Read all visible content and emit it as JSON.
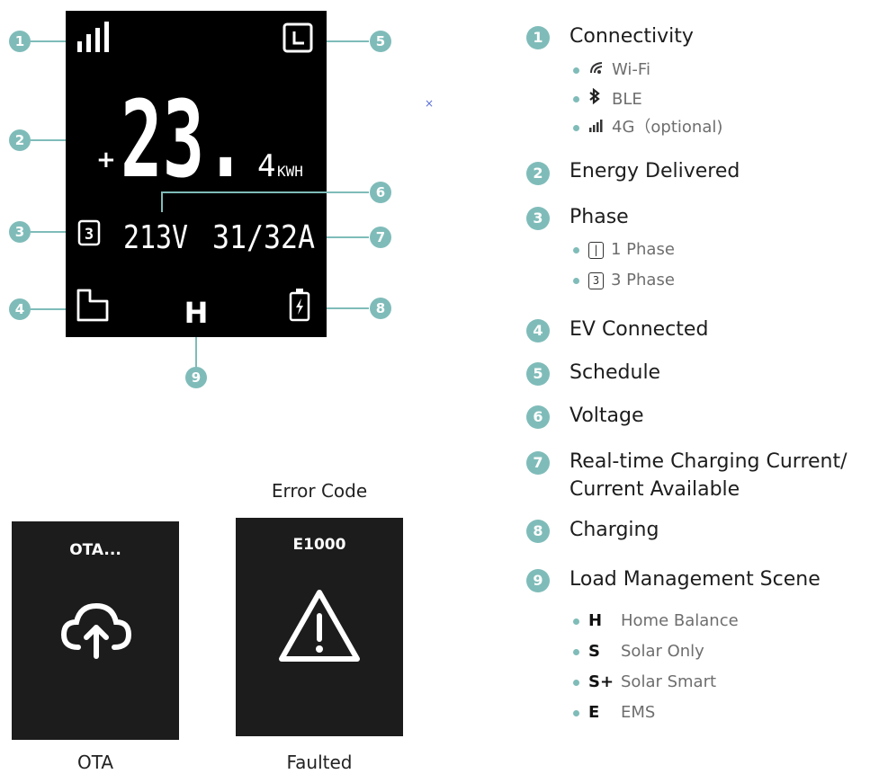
{
  "display": {
    "energy_big": "23.",
    "energy_decimal": "4",
    "energy_unit": "KWH",
    "plus_sign": "+",
    "phase_digit": "3",
    "voltage": "213V",
    "current": "31/32A",
    "scene": "H"
  },
  "callouts": [
    "1",
    "2",
    "3",
    "4",
    "5",
    "6",
    "7",
    "8",
    "9"
  ],
  "stray_mark": "×",
  "legend": {
    "items": [
      {
        "num": "1",
        "title": "Connectivity",
        "subs": [
          {
            "icon": "wifi-icon",
            "text": "Wi-Fi"
          },
          {
            "icon": "bluetooth-icon",
            "text": "BLE"
          },
          {
            "icon": "signal-icon",
            "text": "4G（optional)"
          }
        ]
      },
      {
        "num": "2",
        "title": "Energy Delivered"
      },
      {
        "num": "3",
        "title": "Phase",
        "subs": [
          {
            "box": "|",
            "text": "1 Phase"
          },
          {
            "box": "3",
            "text": "3 Phase"
          }
        ]
      },
      {
        "num": "4",
        "title": "EV Connected"
      },
      {
        "num": "5",
        "title": "Schedule"
      },
      {
        "num": "6",
        "title": "Voltage"
      },
      {
        "num": "7",
        "title": "Real-time Charging Current/",
        "title2": "Current Available"
      },
      {
        "num": "8",
        "title": "Charging"
      },
      {
        "num": "9",
        "title": "Load Management Scene",
        "subs": [
          {
            "key": "H",
            "text": "Home Balance"
          },
          {
            "key": "S",
            "text": "Solar Only"
          },
          {
            "key": "S+",
            "text": "Solar Smart"
          },
          {
            "key": "E",
            "text": "EMS"
          }
        ]
      }
    ]
  },
  "screens": {
    "ota": {
      "label": "OTA...",
      "caption": "OTA",
      "icon": "cloud-upload-icon"
    },
    "fault": {
      "label": "E1000",
      "caption": "Faulted",
      "header": "Error Code",
      "icon": "warning-icon"
    }
  },
  "colors": {
    "accent": "#7fbcb9",
    "screen_bg": "#000000",
    "panel_bg": "#1a1a1a"
  }
}
